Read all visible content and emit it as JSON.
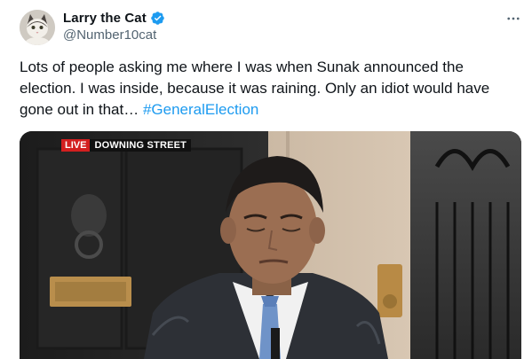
{
  "author": {
    "display_name": "Larry the Cat",
    "handle": "@Number10cat",
    "verified": true,
    "avatar_icon": "cat-avatar-icon"
  },
  "tweet": {
    "text": "Lots of people asking me where I was when Sunak announced the\nelection. I was inside, because it was raining. Only an idiot would have\ngone out in that… ",
    "hashtag": "#GeneralElection"
  },
  "media": {
    "live_label": "LIVE",
    "location_label": "DOWNING STREET"
  },
  "colors": {
    "accent": "#1d9bf0",
    "live_red": "#d31f1f",
    "text": "#0f1419",
    "secondary": "#536471"
  }
}
